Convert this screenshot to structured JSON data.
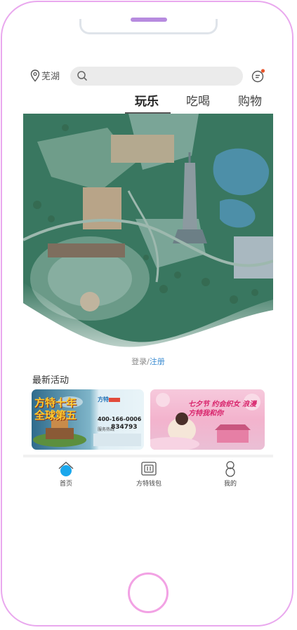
{
  "header": {
    "location": "芜湖",
    "search_placeholder": ""
  },
  "tabs": [
    {
      "label": "玩乐",
      "active": true
    },
    {
      "label": "吃喝",
      "active": false
    },
    {
      "label": "购物",
      "active": false
    }
  ],
  "login": {
    "login_label": "登录",
    "separator": "/",
    "register_label": "注册"
  },
  "activities": {
    "title": "最新活动",
    "cards": [
      {
        "headline": "方特十年 全球第五",
        "brand": "方特",
        "phone": "400-166-0006",
        "hotline_label": "服务热线",
        "hotline": "834793"
      },
      {
        "headline": "七夕节 约会织女 浪漫方特我和你"
      }
    ]
  },
  "tabbar": {
    "items": [
      {
        "label": "首页",
        "icon": "home-icon",
        "active": true
      },
      {
        "label": "方特钱包",
        "icon": "wallet-icon",
        "active": false
      },
      {
        "label": "我的",
        "icon": "user-icon",
        "active": false
      }
    ]
  },
  "colors": {
    "accent": "#3a8bd1",
    "phone_frame": "#e9a8ee",
    "home_button": "#f2a2e4",
    "notification_dot": "#e8552b"
  }
}
